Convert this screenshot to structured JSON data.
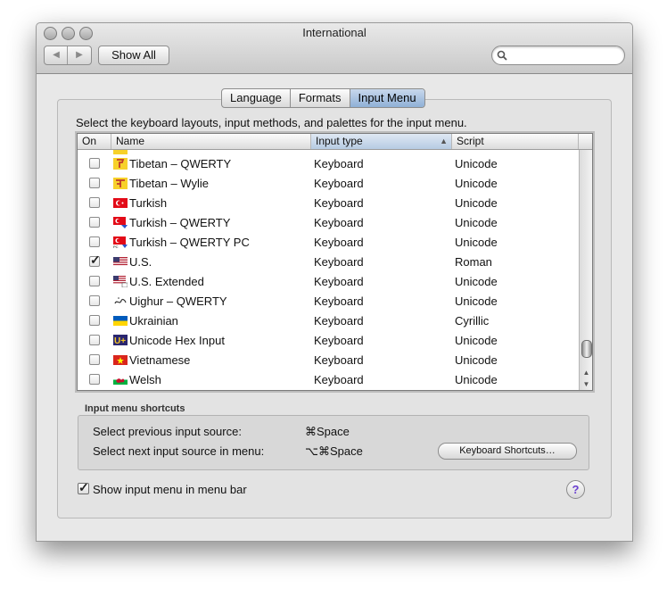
{
  "window": {
    "title": "International"
  },
  "toolbar": {
    "back_label": "◀",
    "forward_label": "▶",
    "show_all_label": "Show All",
    "search_placeholder": ""
  },
  "tabs": [
    {
      "label": "Language",
      "active": false
    },
    {
      "label": "Formats",
      "active": false
    },
    {
      "label": "Input Menu",
      "active": true
    }
  ],
  "description": "Select the keyboard layouts, input methods, and palettes for the input menu.",
  "table": {
    "columns": {
      "on": "On",
      "name": "Name",
      "type": "Input type",
      "script": "Script"
    },
    "sorted_column": "Input type",
    "rows": [
      {
        "checked": false,
        "flag": "tibetan-icon",
        "name": "Tibetan – QWERTY",
        "type": "Keyboard",
        "script": "Unicode"
      },
      {
        "checked": false,
        "flag": "tibetan-icon",
        "name": "Tibetan – Wylie",
        "type": "Keyboard",
        "script": "Unicode"
      },
      {
        "checked": false,
        "flag": "turkey-flag-icon",
        "name": "Turkish",
        "type": "Keyboard",
        "script": "Unicode"
      },
      {
        "checked": false,
        "flag": "turkey-flag-icon",
        "name": "Turkish – QWERTY",
        "type": "Keyboard",
        "script": "Unicode"
      },
      {
        "checked": false,
        "flag": "turkey-flag-icon",
        "name": "Turkish – QWERTY PC",
        "type": "Keyboard",
        "script": "Unicode"
      },
      {
        "checked": true,
        "flag": "us-flag-icon",
        "name": "U.S.",
        "type": "Keyboard",
        "script": "Roman"
      },
      {
        "checked": false,
        "flag": "us-flag-icon",
        "name": "U.S. Extended",
        "type": "Keyboard",
        "script": "Unicode"
      },
      {
        "checked": false,
        "flag": "uighur-icon",
        "name": "Uighur – QWERTY",
        "type": "Keyboard",
        "script": "Unicode"
      },
      {
        "checked": false,
        "flag": "ukraine-flag-icon",
        "name": "Ukrainian",
        "type": "Keyboard",
        "script": "Cyrillic"
      },
      {
        "checked": false,
        "flag": "unicode-icon",
        "name": "Unicode Hex Input",
        "type": "Keyboard",
        "script": "Unicode"
      },
      {
        "checked": false,
        "flag": "vietnam-flag-icon",
        "name": "Vietnamese",
        "type": "Keyboard",
        "script": "Unicode"
      },
      {
        "checked": false,
        "flag": "wales-flag-icon",
        "name": "Welsh",
        "type": "Keyboard",
        "script": "Unicode"
      }
    ]
  },
  "shortcuts": {
    "title": "Input menu shortcuts",
    "previous_label": "Select previous input source:",
    "previous_key": "⌘Space",
    "next_label": "Select next input source in menu:",
    "next_key": "⌥⌘Space",
    "button_label": "Keyboard Shortcuts…"
  },
  "show_in_menu_bar": {
    "label": "Show input menu in menu bar",
    "checked": true
  },
  "help_label": "?",
  "colors": {
    "selected_tab": "#8fb0d6",
    "help_accent": "#6a3fd0",
    "turkey_red": "#e30a17",
    "ukraine_blue": "#005bbb",
    "ukraine_yellow": "#ffd500"
  }
}
